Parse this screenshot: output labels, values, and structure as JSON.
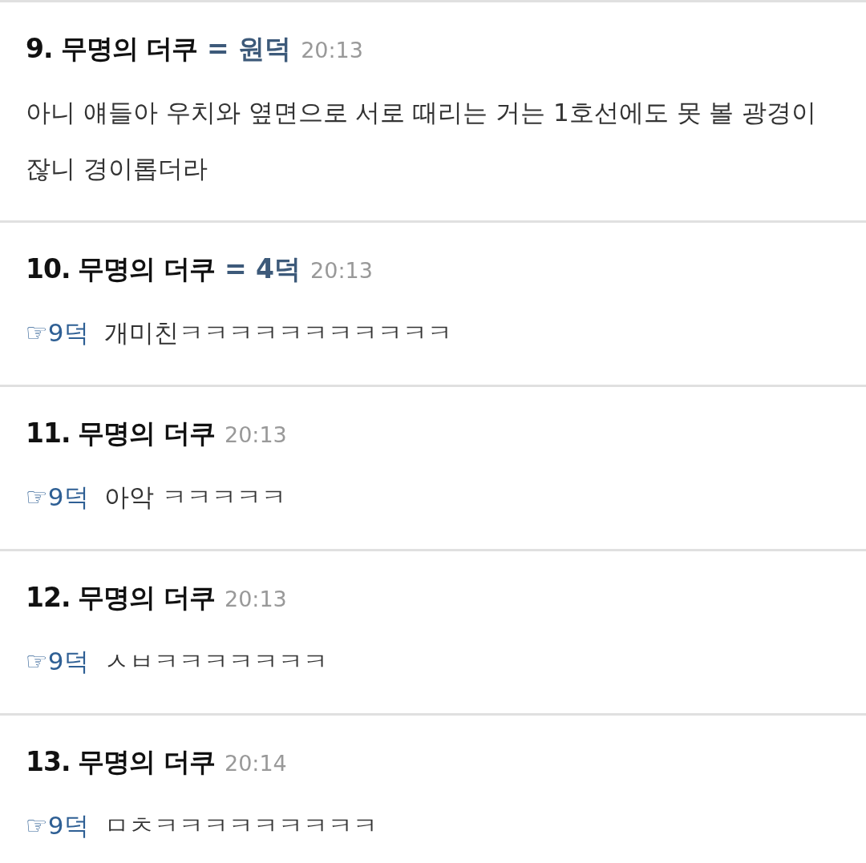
{
  "comments": [
    {
      "number": "9.",
      "author": "무명의 더쿠",
      "tag": "= 원덕",
      "time": "20:13",
      "text": "아니 얘들아 우치와 옆면으로 서로 때리는 거는 1호선에도 못 볼 광경이잖니 경이롭더라"
    },
    {
      "number": "10.",
      "author": "무명의 더쿠",
      "tag": "= 4덕",
      "time": "20:13",
      "reply_to": "☞9덕",
      "text": "개미친ㅋㅋㅋㅋㅋㅋㅋㅋㅋㅋㅋ"
    },
    {
      "number": "11.",
      "author": "무명의 더쿠",
      "time": "20:13",
      "reply_to": "☞9덕",
      "text": "아악 ㅋㅋㅋㅋㅋ"
    },
    {
      "number": "12.",
      "author": "무명의 더쿠",
      "time": "20:13",
      "reply_to": "☞9덕",
      "text": "ㅅㅂㅋㅋㅋㅋㅋㅋㅋ"
    },
    {
      "number": "13.",
      "author": "무명의 더쿠",
      "time": "20:14",
      "reply_to": "☞9덕",
      "text": "ㅁㅊㅋㅋㅋㅋㅋㅋㅋㅋㅋ"
    }
  ]
}
